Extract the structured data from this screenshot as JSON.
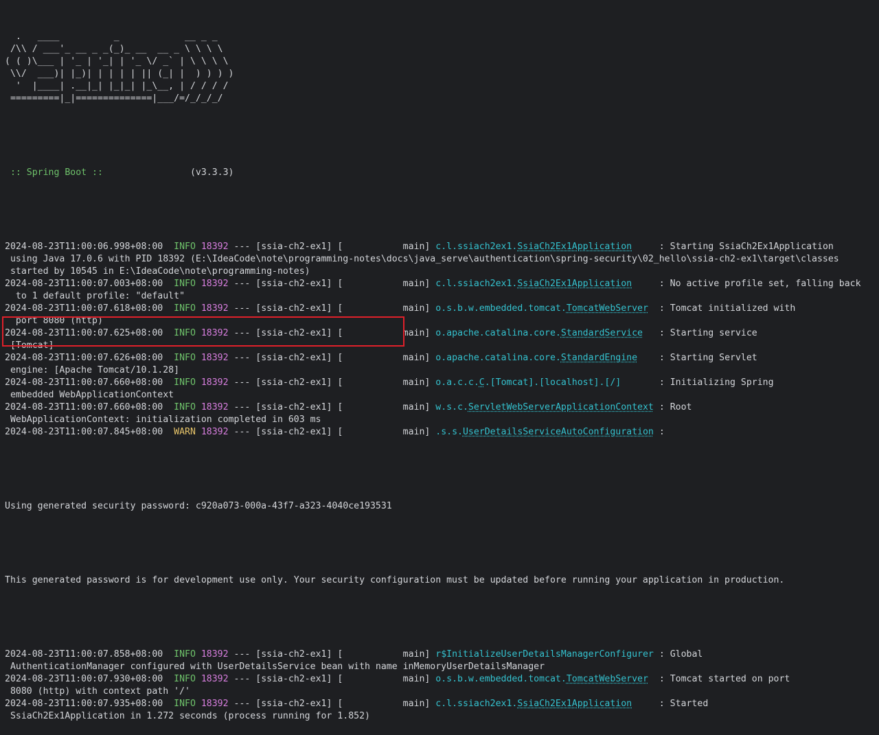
{
  "banner": [
    "  .   ____          _            __ _ _",
    " /\\\\ / ___'_ __ _ _(_)_ __  __ _ \\ \\ \\ \\",
    "( ( )\\___ | '_ | '_| | '_ \\/ _` | \\ \\ \\ \\",
    " \\\\/  ___)| |_)| | | | | || (_| |  ) ) ) )",
    "  '  |____| .__|_| |_|_| |_\\__, | / / / /",
    " =========|_|==============|___/=/_/_/_/"
  ],
  "boot": {
    "label": " :: Spring Boot :: ",
    "version": "               (v3.3.3)"
  },
  "log": [
    {
      "ts": "2024-08-23T11:00:06.998+08:00",
      "level": "INFO",
      "pid": "18392",
      "thread": " --- [ssia-ch2-ex1] [           main] ",
      "logger_prefix": "c.l.ssiach2ex1.",
      "logger_class": "SsiaCh2Ex1Application",
      "pad": "     ",
      "msg": ": Starting SsiaCh2Ex1Application",
      "cont": [
        " using Java 17.0.6 with PID 18392 (E:\\IdeaCode\\note\\programming-notes\\docs\\java_serve\\authentication\\spring-security\\02_hello\\ssia-ch2-ex1\\target\\classes",
        " started by 10545 in E:\\IdeaCode\\note\\programming-notes)"
      ]
    },
    {
      "ts": "2024-08-23T11:00:07.003+08:00",
      "level": "INFO",
      "pid": "18392",
      "thread": " --- [ssia-ch2-ex1] [           main] ",
      "logger_prefix": "c.l.ssiach2ex1.",
      "logger_class": "SsiaCh2Ex1Application",
      "pad": "     ",
      "msg": ": No active profile set, falling back",
      "cont": [
        "  to 1 default profile: \"default\""
      ]
    },
    {
      "ts": "2024-08-23T11:00:07.618+08:00",
      "level": "INFO",
      "pid": "18392",
      "thread": " --- [ssia-ch2-ex1] [           main] ",
      "logger_prefix": "o.s.b.w.embedded.tomcat.",
      "logger_class": "TomcatWebServer",
      "pad": "  ",
      "msg": ": Tomcat initialized with",
      "cont": [
        "  port 8080 (http)"
      ]
    },
    {
      "ts": "2024-08-23T11:00:07.625+08:00",
      "level": "INFO",
      "pid": "18392",
      "thread": " --- [ssia-ch2-ex1] [           main] ",
      "logger_prefix": "o.apache.catalina.core.",
      "logger_class": "StandardService",
      "pad": "   ",
      "msg": ": Starting service",
      "cont": [
        " [Tomcat]"
      ]
    },
    {
      "ts": "2024-08-23T11:00:07.626+08:00",
      "level": "INFO",
      "pid": "18392",
      "thread": " --- [ssia-ch2-ex1] [           main] ",
      "logger_prefix": "o.apache.catalina.core.",
      "logger_class": "StandardEngine",
      "pad": "    ",
      "msg": ": Starting Servlet",
      "cont": [
        " engine: [Apache Tomcat/10.1.28]"
      ]
    },
    {
      "ts": "2024-08-23T11:00:07.660+08:00",
      "level": "INFO",
      "pid": "18392",
      "thread": " --- [ssia-ch2-ex1] [           main] ",
      "logger_prefix": "o.a.c.c.",
      "logger_class": "C",
      "logger_suffix": ".[Tomcat].[localhost].[/]",
      "pad": "       ",
      "msg": ": Initializing Spring",
      "cont": [
        " embedded WebApplicationContext"
      ]
    },
    {
      "ts": "2024-08-23T11:00:07.660+08:00",
      "level": "INFO",
      "pid": "18392",
      "thread": " --- [ssia-ch2-ex1] [           main] ",
      "logger_prefix": "w.s.c.",
      "logger_class": "ServletWebServerApplicationContext",
      "pad": " ",
      "msg": ": Root",
      "cont": [
        " WebApplicationContext: initialization completed in 603 ms"
      ]
    },
    {
      "ts": "2024-08-23T11:00:07.845+08:00",
      "level": "WARN",
      "pid": "18392",
      "thread": " --- [ssia-ch2-ex1] [           main] ",
      "logger_prefix": ".s.s.",
      "logger_class": "UserDetailsServiceAutoConfiguration",
      "pad": " ",
      "msg": ":",
      "cont": []
    }
  ],
  "password_line": "Using generated security password: c920a073-000a-43f7-a323-4040ce193531",
  "dev_note": "This generated password is for development use only. Your security configuration must be updated before running your application in production.",
  "log2": [
    {
      "ts": "2024-08-23T11:00:07.858+08:00",
      "level": "INFO",
      "pid": "18392",
      "thread": " --- [ssia-ch2-ex1] [           main] ",
      "logger_prefix": "r$InitializeUserDetailsManagerConfigurer",
      "logger_class": "",
      "pad": " ",
      "msg": ": Global",
      "cont": [
        " AuthenticationManager configured with UserDetailsService bean with name inMemoryUserDetailsManager"
      ]
    },
    {
      "ts": "2024-08-23T11:00:07.930+08:00",
      "level": "INFO",
      "pid": "18392",
      "thread": " --- [ssia-ch2-ex1] [           main] ",
      "logger_prefix": "o.s.b.w.embedded.tomcat.",
      "logger_class": "TomcatWebServer",
      "pad": "  ",
      "msg": ": Tomcat started on port",
      "cont": [
        " 8080 (http) with context path '/'"
      ]
    },
    {
      "ts": "2024-08-23T11:00:07.935+08:00",
      "level": "INFO",
      "pid": "18392",
      "thread": " --- [ssia-ch2-ex1] [           main] ",
      "logger_prefix": "c.l.ssiach2ex1.",
      "logger_class": "SsiaCh2Ex1Application",
      "pad": "     ",
      "msg": ": Started",
      "cont": [
        " SsiaCh2Ex1Application in 1.272 seconds (process running for 1.852)"
      ]
    }
  ],
  "colors": {
    "background": "#1e1f22",
    "text": "#d4d6da",
    "info": "#6fc36b",
    "warn": "#e6c46a",
    "pid": "#d97fe0",
    "logger": "#34c2cf",
    "highlight_border": "#e0202a"
  }
}
